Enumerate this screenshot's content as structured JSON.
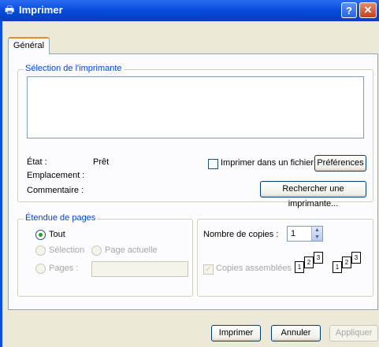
{
  "window": {
    "title": "Imprimer",
    "help_label": "?",
    "close_label": "✕"
  },
  "tabs": [
    {
      "label": "Général"
    }
  ],
  "printer_group": {
    "legend": "Sélection de l'imprimante",
    "state_label": "État :",
    "state_value": "Prêt",
    "location_label": "Emplacement :",
    "comment_label": "Commentaire :",
    "print_to_file_label": "Imprimer dans un fichier",
    "print_to_file_checked": false,
    "preferences_button": "Préférences",
    "find_printer_button": "Rechercher une imprimante..."
  },
  "page_range_group": {
    "legend": "Étendue de pages",
    "all_label": "Tout",
    "all_selected": true,
    "selection_label": "Sélection",
    "current_page_label": "Page actuelle",
    "pages_label": "Pages :",
    "pages_value": ""
  },
  "copies_group": {
    "copies_label": "Nombre de copies :",
    "copies_value": "1",
    "collate_label": "Copies assemblées",
    "collate_checked": true,
    "collate_pages": [
      "1",
      "2",
      "3"
    ]
  },
  "footer": {
    "print_button": "Imprimer",
    "cancel_button": "Annuler",
    "apply_button": "Appliquer"
  },
  "colors": {
    "titlebar": "#0a4fe0",
    "dialog_bg": "#ece9d8",
    "group_legend": "#0046d5",
    "radio_dot": "#21a121"
  }
}
